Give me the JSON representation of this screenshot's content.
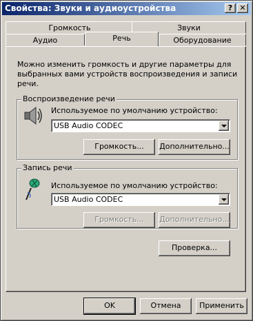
{
  "window": {
    "title": "Свойства: Звуки и аудиоустройства",
    "help_glyph": "?",
    "close_glyph": "✕"
  },
  "tabs": {
    "back": [
      "Громкость",
      "Звуки"
    ],
    "front": [
      "Аудио",
      "Речь",
      "Оборудование"
    ],
    "active": "Речь"
  },
  "description": "Можно изменить громкость и другие параметры для выбранных вами устройств воспроизведения и записи речи.",
  "playback": {
    "legend": "Воспроизведение речи",
    "device_label": "Используемое по умолчанию устройство:",
    "device_value": "USB Audio CODEC",
    "volume_button": "Громкость...",
    "advanced_button": "Дополнительно..."
  },
  "record": {
    "legend": "Запись речи",
    "device_label": "Используемое по умолчанию устройство:",
    "device_value": "USB Audio CODEC",
    "volume_button": "Громкость...",
    "advanced_button": "Дополнительно..."
  },
  "test_button": "Проверка...",
  "footer": {
    "ok": "OK",
    "cancel": "Отмена",
    "apply": "Применить"
  }
}
